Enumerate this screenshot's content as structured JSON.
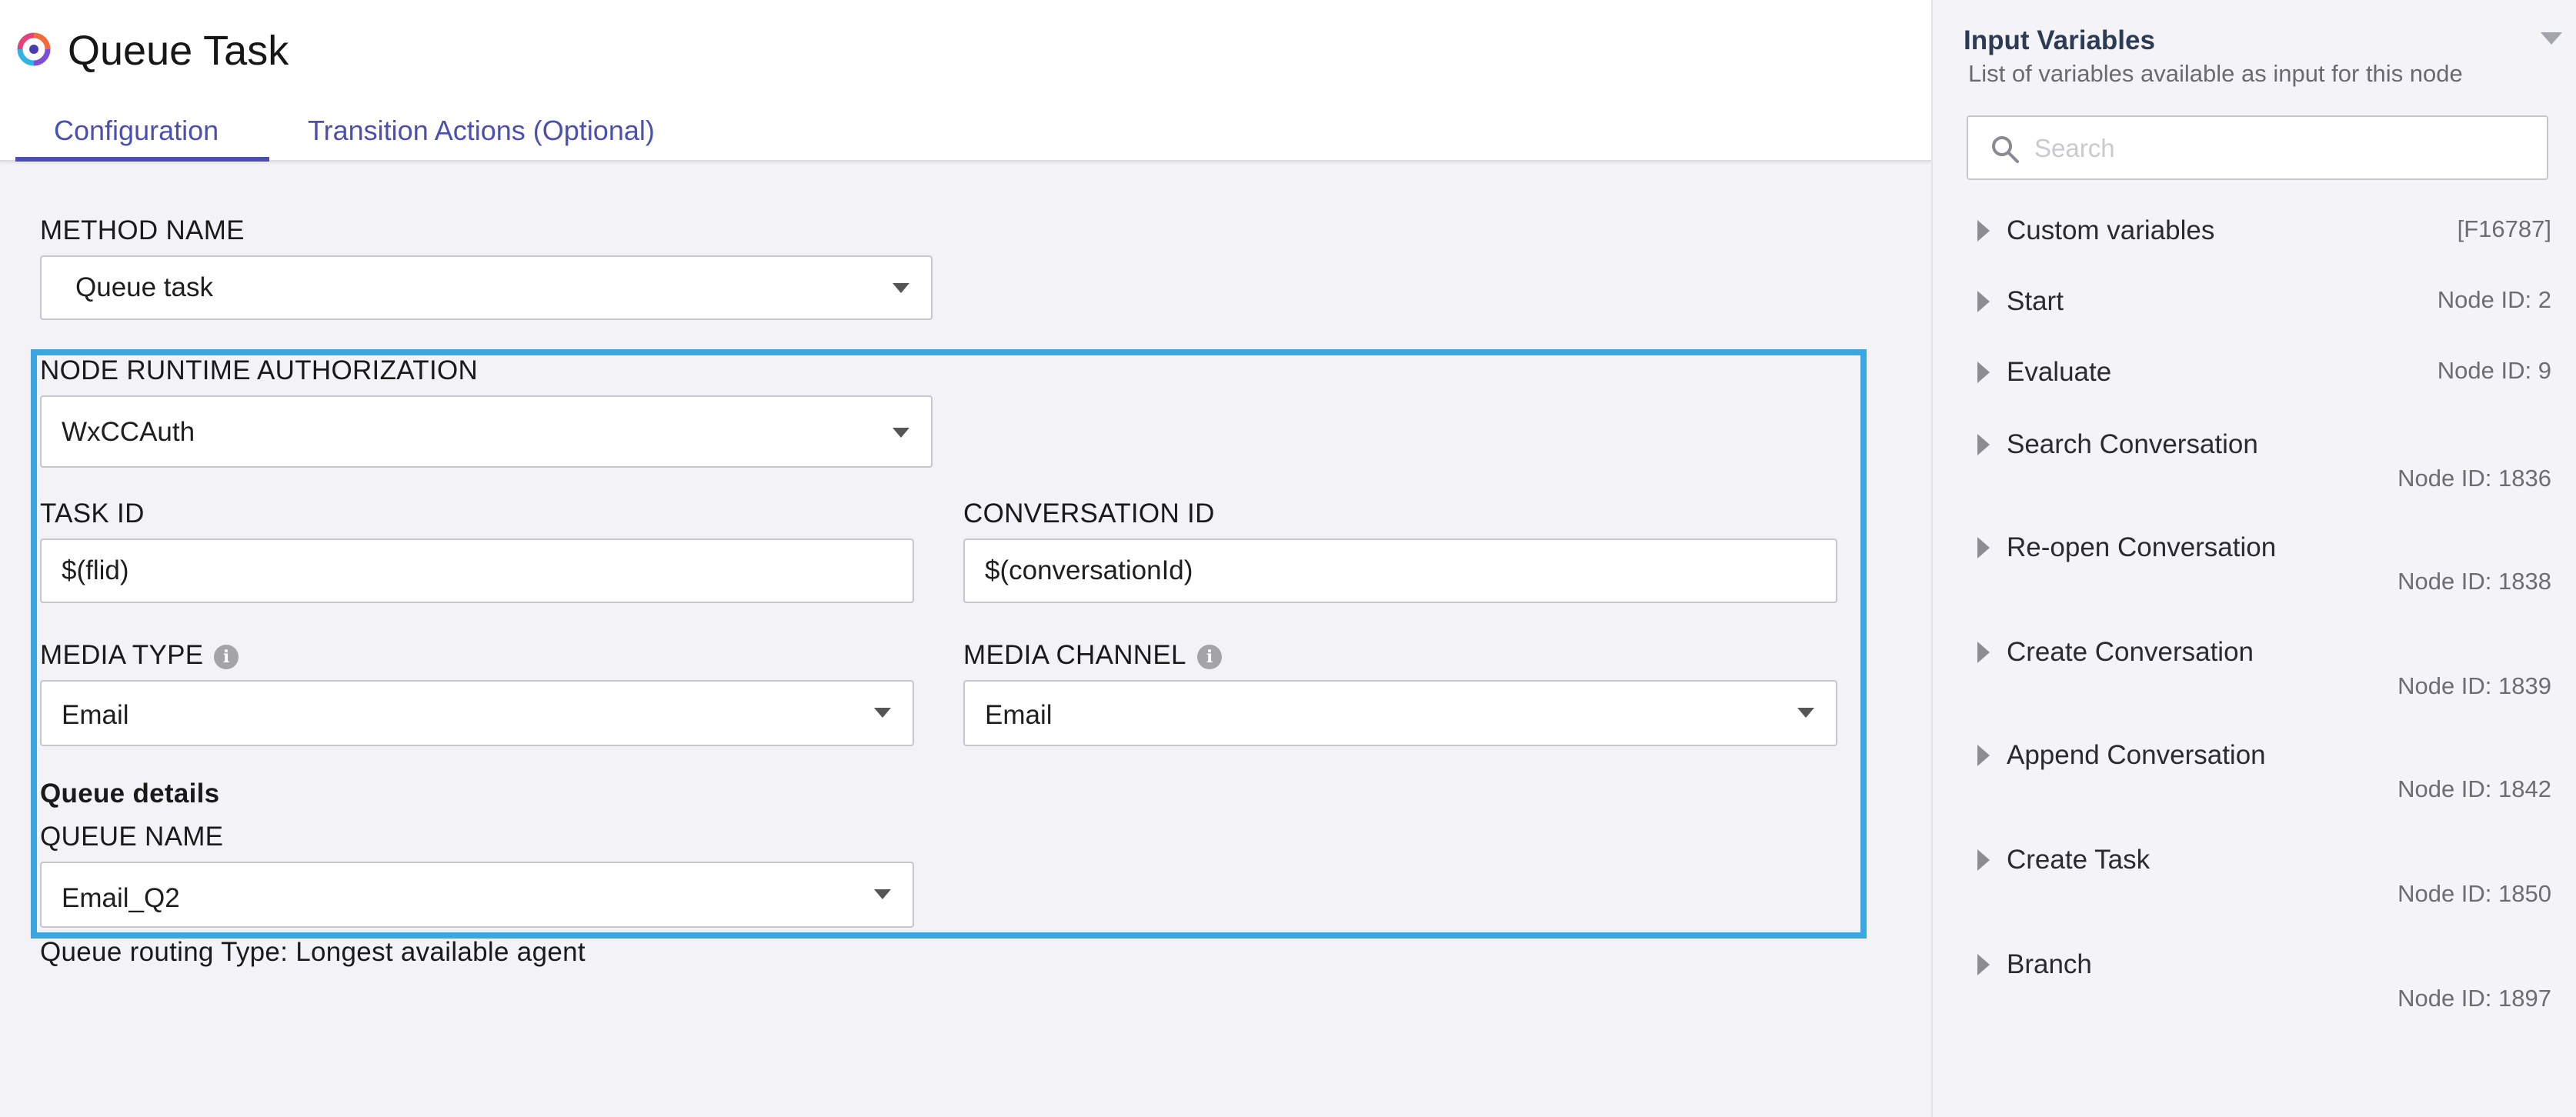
{
  "header": {
    "title": "Queue Task",
    "tabs": [
      {
        "label": "Configuration",
        "active": true
      },
      {
        "label": "Transition Actions (Optional)",
        "active": false
      }
    ]
  },
  "form": {
    "method_name": {
      "label": "METHOD NAME",
      "value": "Queue task"
    },
    "auth": {
      "label": "NODE RUNTIME AUTHORIZATION",
      "value": "WxCCAuth"
    },
    "task_id": {
      "label": "TASK ID",
      "value": "$(flid)"
    },
    "conversation_id": {
      "label": "CONVERSATION ID",
      "value": "$(conversationId)"
    },
    "media_type": {
      "label": "MEDIA TYPE",
      "value": "Email"
    },
    "media_channel": {
      "label": "MEDIA CHANNEL",
      "value": "Email"
    },
    "queue_section": "Queue details",
    "queue_name": {
      "label": "QUEUE NAME",
      "value": "Email_Q2"
    },
    "routing_type": "Queue routing Type: Longest available agent"
  },
  "input_variables": {
    "title": "Input Variables",
    "subtitle": "List of variables available as input for this node",
    "search_placeholder": "Search",
    "items": [
      {
        "label": "Custom variables",
        "meta": "[F16787]"
      },
      {
        "label": "Start",
        "meta": "Node ID: 2"
      },
      {
        "label": "Evaluate",
        "meta": "Node ID: 9"
      },
      {
        "label": "Search Conversation",
        "meta": "Node ID: 1836"
      },
      {
        "label": "Re-open Conversation",
        "meta": "Node ID: 1838"
      },
      {
        "label": "Create Conversation",
        "meta": "Node ID: 1839"
      },
      {
        "label": "Append Conversation",
        "meta": "Node ID: 1842"
      },
      {
        "label": "Create Task",
        "meta": "Node ID: 1850"
      },
      {
        "label": "Branch",
        "meta": "Node ID: 1897"
      }
    ]
  },
  "colors": {
    "accent": "#4b4fb0",
    "highlight_border": "#3aa7e2",
    "background": "#f3f3f7"
  },
  "icons": [
    "webex-logo-icon",
    "chevron-down-icon",
    "info-icon",
    "search-icon",
    "caret-right-icon",
    "collapse-icon"
  ]
}
